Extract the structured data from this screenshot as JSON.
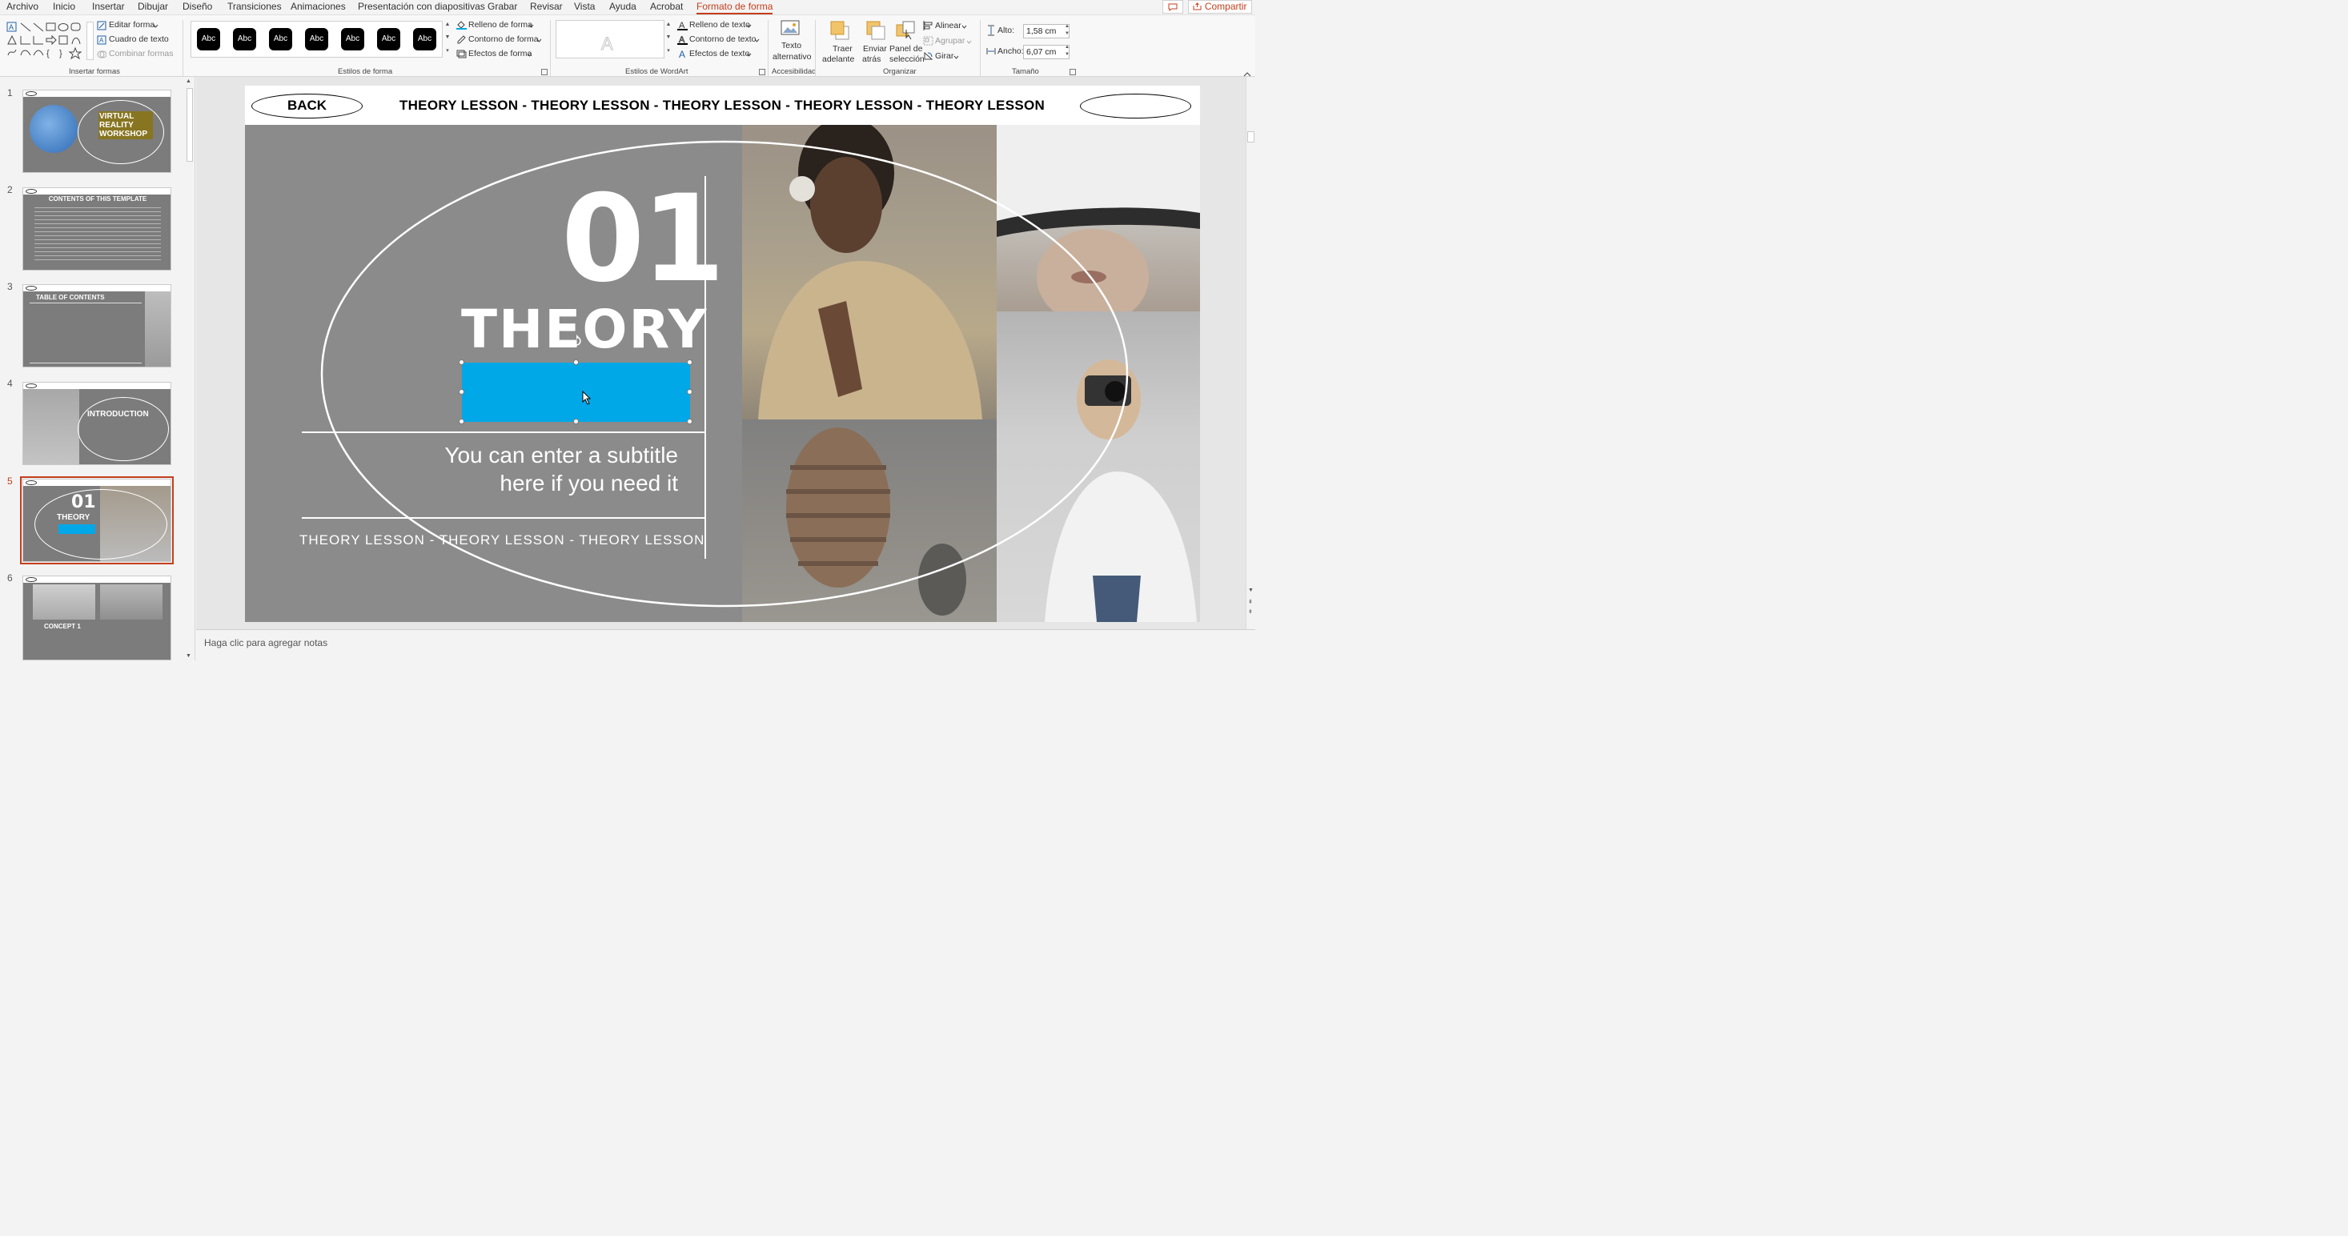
{
  "menu": {
    "items": [
      "Archivo",
      "Inicio",
      "Insertar",
      "Dibujar",
      "Diseño",
      "Transiciones",
      "Animaciones",
      "Presentación con diapositivas",
      "Grabar",
      "Revisar",
      "Vista",
      "Ayuda",
      "Acrobat",
      "Formato de forma"
    ],
    "active": "Formato de forma",
    "share_label": "Compartir"
  },
  "ribbon": {
    "insert_shapes": {
      "label": "Insertar formas",
      "edit_shape": "Editar forma",
      "text_box": "Cuadro de texto",
      "merge_shapes": "Combinar formas"
    },
    "shape_styles": {
      "label": "Estilos de forma",
      "preset": "Abc",
      "fill": "Relleno de forma",
      "outline": "Contorno de forma",
      "effects": "Efectos de forma"
    },
    "wordart": {
      "label": "Estilos de WordArt",
      "text_fill": "Relleno de texto",
      "text_outline": "Contorno de texto",
      "text_effects": "Efectos de texto"
    },
    "accessibility": {
      "label": "Accesibilidad",
      "alt_text_1": "Texto",
      "alt_text_2": "alternativo"
    },
    "arrange": {
      "label": "Organizar",
      "bring_forward_1": "Traer",
      "bring_forward_2": "adelante",
      "send_backward_1": "Enviar",
      "send_backward_2": "atrás",
      "selection_pane_1": "Panel de",
      "selection_pane_2": "selección",
      "align": "Alinear",
      "group": "Agrupar",
      "rotate": "Girar"
    },
    "size": {
      "label": "Tamaño",
      "height_label": "Alto:",
      "height_value": "1,58 cm",
      "width_label": "Ancho:",
      "width_value": "6,07 cm"
    }
  },
  "thumbnails": [
    {
      "number": "1",
      "title": "VIRTUAL REALITY WORKSHOP"
    },
    {
      "number": "2",
      "title": "CONTENTS OF THIS TEMPLATE"
    },
    {
      "number": "3",
      "title": "TABLE OF CONTENTS"
    },
    {
      "number": "4",
      "title": "INTRODUCTION"
    },
    {
      "number": "5",
      "title": "THEORY"
    },
    {
      "number": "6",
      "title": "CONCEPT 1"
    }
  ],
  "slide": {
    "back_label": "BACK",
    "header_marquee": "THEORY LESSON - THEORY LESSON - THEORY LESSON - THEORY LESSON - THEORY LESSON",
    "number": "01",
    "title": "THEORY",
    "subtitle_line1": "You can enter a subtitle",
    "subtitle_line2": "here if you need it",
    "footer_marquee": "THEORY LESSON - THEORY LESSON - THEORY LESSON",
    "selected_shape_color": "#00A8E8"
  },
  "notes": {
    "placeholder": "Haga clic para agregar notas"
  },
  "colors": {
    "accent": "#C43E1C",
    "slide_bg": "#8B8B8B"
  }
}
